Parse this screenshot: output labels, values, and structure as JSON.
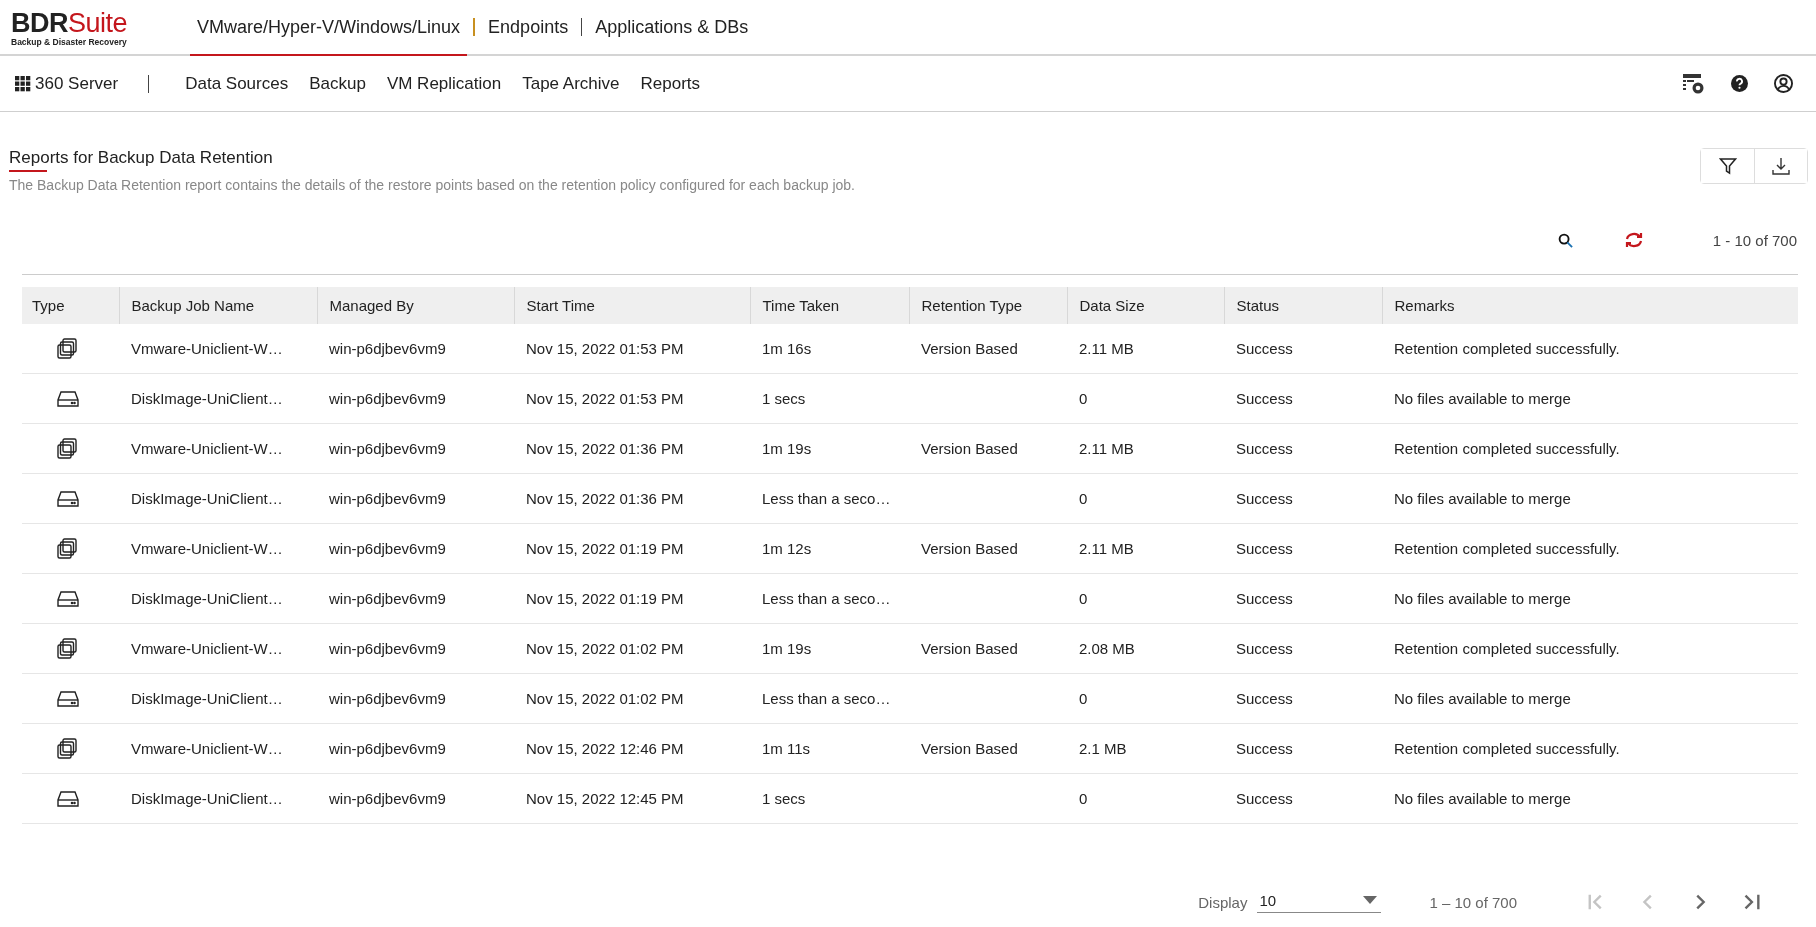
{
  "logo": {
    "name_dark": "BDR",
    "name_red": "Suite",
    "tagline": "Backup & Disaster Recovery"
  },
  "product_tabs": [
    {
      "label": "VMware/Hyper-V/Windows/Linux",
      "selected": true
    },
    {
      "label": "Endpoints",
      "selected": false
    },
    {
      "label": "Applications & DBs",
      "selected": false
    }
  ],
  "server": {
    "label": "360 Server"
  },
  "nav": [
    {
      "label": "Data Sources"
    },
    {
      "label": "Backup"
    },
    {
      "label": "VM Replication"
    },
    {
      "label": "Tape Archive"
    },
    {
      "label": "Reports"
    }
  ],
  "page": {
    "title": "Reports for Backup Data Retention",
    "description": "The Backup Data Retention report contains the details of the restore points based on the retention policy configured for each backup job."
  },
  "range_top": "1 - 10 of 700",
  "table": {
    "columns": [
      "Type",
      "Backup Job Name",
      "Managed By",
      "Start Time",
      "Time Taken",
      "Retention Type",
      "Data Size",
      "Status",
      "Remarks"
    ],
    "rows": [
      {
        "kind": "vm",
        "name": "Vmware-Uniclient-W…",
        "managed_by": "win-p6djbev6vm9",
        "start": "Nov 15, 2022 01:53 PM",
        "taken": "1m 16s",
        "retention": "Version Based",
        "size": "2.11 MB",
        "status": "Success",
        "remarks": "Retention completed successfully."
      },
      {
        "kind": "disk",
        "name": "DiskImage-UniClient…",
        "managed_by": "win-p6djbev6vm9",
        "start": "Nov 15, 2022 01:53 PM",
        "taken": "1 secs",
        "size": "0",
        "status": "Success",
        "remarks": "No files available to merge"
      },
      {
        "kind": "vm",
        "name": "Vmware-Uniclient-W…",
        "managed_by": "win-p6djbev6vm9",
        "start": "Nov 15, 2022 01:36 PM",
        "taken": "1m 19s",
        "retention": "Version Based",
        "size": "2.11 MB",
        "status": "Success",
        "remarks": "Retention completed successfully."
      },
      {
        "kind": "disk",
        "name": "DiskImage-UniClient…",
        "managed_by": "win-p6djbev6vm9",
        "start": "Nov 15, 2022 01:36 PM",
        "taken": "Less than a seco…",
        "size": "0",
        "status": "Success",
        "remarks": "No files available to merge"
      },
      {
        "kind": "vm",
        "name": "Vmware-Uniclient-W…",
        "managed_by": "win-p6djbev6vm9",
        "start": "Nov 15, 2022 01:19 PM",
        "taken": "1m 12s",
        "retention": "Version Based",
        "size": "2.11 MB",
        "status": "Success",
        "remarks": "Retention completed successfully."
      },
      {
        "kind": "disk",
        "name": "DiskImage-UniClient…",
        "managed_by": "win-p6djbev6vm9",
        "start": "Nov 15, 2022 01:19 PM",
        "taken": "Less than a seco…",
        "size": "0",
        "status": "Success",
        "remarks": "No files available to merge"
      },
      {
        "kind": "vm",
        "name": "Vmware-Uniclient-W…",
        "managed_by": "win-p6djbev6vm9",
        "start": "Nov 15, 2022 01:02 PM",
        "taken": "1m 19s",
        "retention": "Version Based",
        "size": "2.08 MB",
        "status": "Success",
        "remarks": "Retention completed successfully."
      },
      {
        "kind": "disk",
        "name": "DiskImage-UniClient…",
        "managed_by": "win-p6djbev6vm9",
        "start": "Nov 15, 2022 01:02 PM",
        "taken": "Less than a seco…",
        "size": "0",
        "status": "Success",
        "remarks": "No files available to merge"
      },
      {
        "kind": "vm",
        "name": "Vmware-Uniclient-W…",
        "managed_by": "win-p6djbev6vm9",
        "start": "Nov 15, 2022 12:46 PM",
        "taken": "1m 11s",
        "retention": "Version Based",
        "size": "2.1 MB",
        "status": "Success",
        "remarks": "Retention completed successfully."
      },
      {
        "kind": "disk",
        "name": "DiskImage-UniClient…",
        "managed_by": "win-p6djbev6vm9",
        "start": "Nov 15, 2022 12:45 PM",
        "taken": "1 secs",
        "size": "0",
        "status": "Success",
        "remarks": "No files available to merge"
      }
    ]
  },
  "pagination": {
    "display_label": "Display",
    "page_size": "10",
    "range": "1 – 10 of 700",
    "buttons": [
      {
        "kind": "first",
        "disabled": true
      },
      {
        "kind": "prev",
        "disabled": true
      },
      {
        "kind": "next",
        "disabled": false
      },
      {
        "kind": "last",
        "disabled": false
      }
    ]
  }
}
